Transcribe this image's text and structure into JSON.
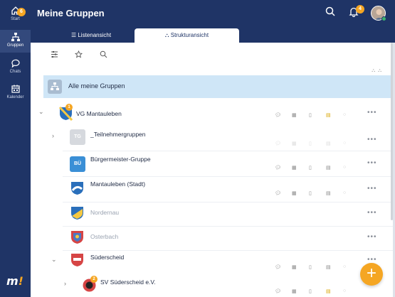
{
  "rail": {
    "start": {
      "label": "Start",
      "badge": "6"
    },
    "gruppen": {
      "label": "Gruppen"
    },
    "chats": {
      "label": "Chats"
    },
    "kalender": {
      "label": "Kalender"
    },
    "brand": {
      "text": "m",
      "mark": "!"
    }
  },
  "header": {
    "title": "Meine Gruppen",
    "notification_badge": "4"
  },
  "tabs": [
    {
      "label": "Listenansicht"
    },
    {
      "label": "Strukturansicht"
    }
  ],
  "tree": {
    "all_groups": "Alle meine Gruppen",
    "groups": [
      {
        "name": "VG Mantauleben",
        "badge": "1"
      },
      {
        "name": "_Teilnehmergruppen",
        "initials": "TG"
      },
      {
        "name": "Bürgermeister-Gruppe",
        "initials": "BÜ"
      },
      {
        "name": "Mantauleben (Stadt)"
      },
      {
        "name": "Nordernau"
      },
      {
        "name": "Osterbach"
      },
      {
        "name": "Süderscheid"
      },
      {
        "name": "SV Süderscheid e.V.",
        "badge": "2"
      }
    ],
    "more": "•••"
  },
  "fab": {
    "label": "+"
  },
  "colors": {
    "navy": "#1f3466",
    "accent": "#f5a623",
    "highlight": "#cfe6f7"
  }
}
